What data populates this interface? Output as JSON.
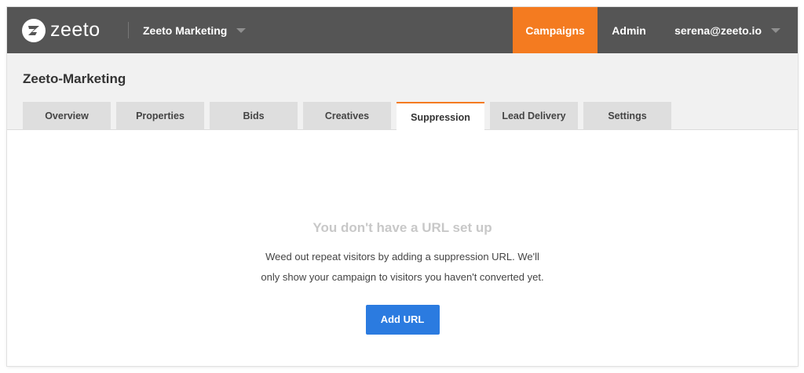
{
  "brand": {
    "name": "zeeto",
    "accent": "#f47b20",
    "topbar_bg": "#555555"
  },
  "topbar": {
    "org_name": "Zeeto Marketing",
    "nav": {
      "campaigns": "Campaigns",
      "admin": "Admin"
    },
    "user_email": "serena@zeeto.io"
  },
  "page": {
    "title": "Zeeto-Marketing"
  },
  "tabs": [
    {
      "label": "Overview"
    },
    {
      "label": "Properties"
    },
    {
      "label": "Bids"
    },
    {
      "label": "Creatives"
    },
    {
      "label": "Suppression",
      "active": true
    },
    {
      "label": "Lead Delivery"
    },
    {
      "label": "Settings"
    }
  ],
  "empty_state": {
    "title": "You don't have a URL set up",
    "description_line1": "Weed out repeat visitors by adding a suppression URL. We'll",
    "description_line2": "only show your campaign to visitors you haven't converted yet.",
    "button_label": "Add URL",
    "button_color": "#2b7be0"
  }
}
